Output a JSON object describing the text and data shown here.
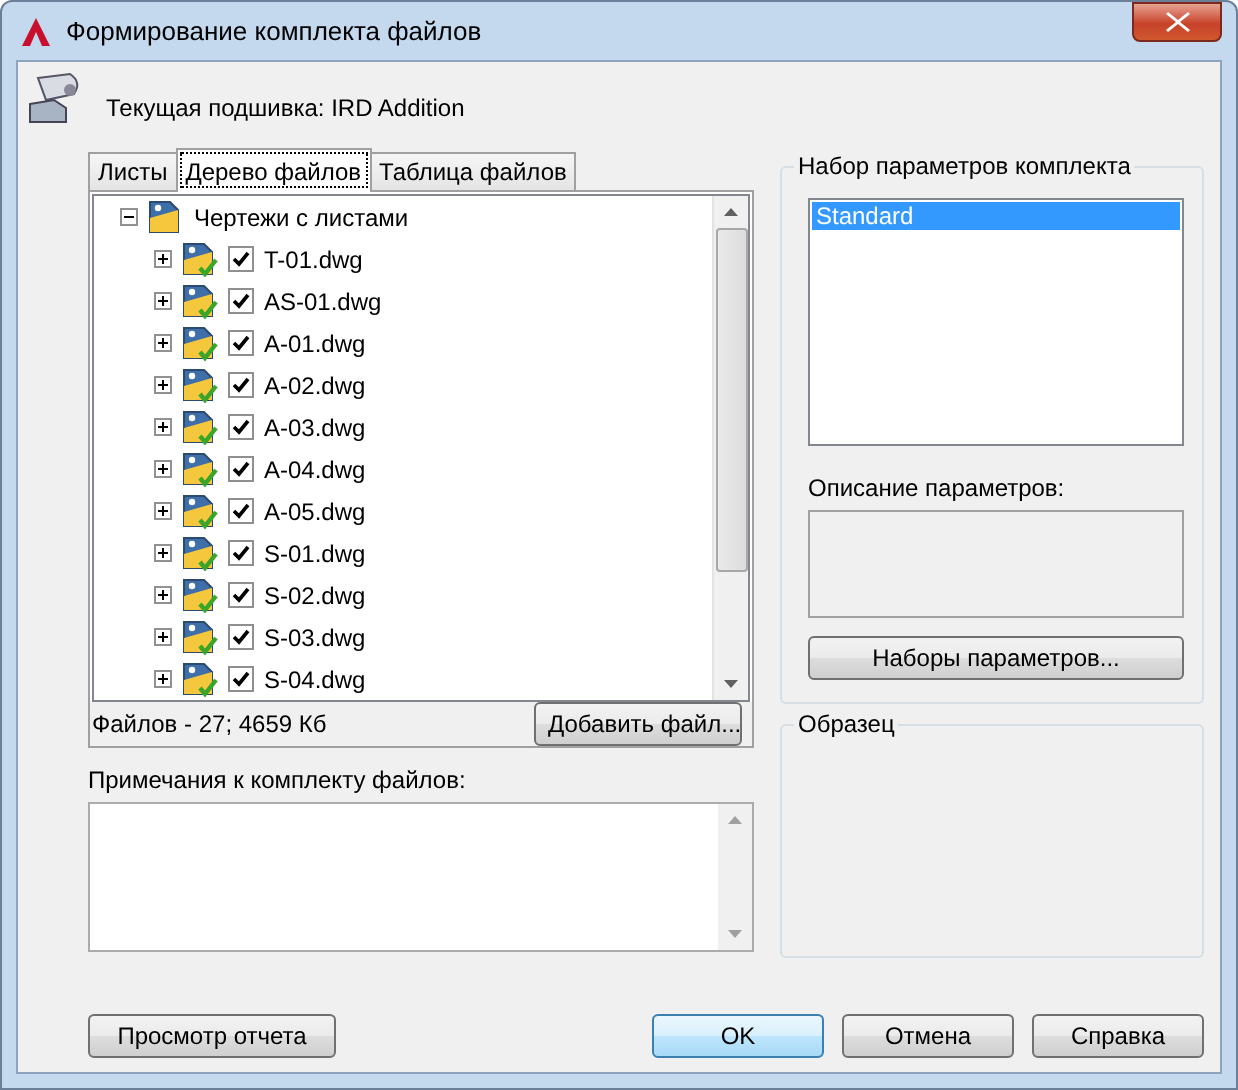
{
  "window": {
    "title": "Формирование комплекта файлов"
  },
  "current_sheet_set": "Текущая подшивка: IRD Addition",
  "tabs": [
    {
      "label": "Листы",
      "selected": false
    },
    {
      "label": "Дерево файлов",
      "selected": true
    },
    {
      "label": "Таблица файлов",
      "selected": false
    }
  ],
  "tree": {
    "label": "Чертежи с листами",
    "expanded": true,
    "children": [
      {
        "label": "T-01.dwg",
        "checked": true,
        "expanded": false
      },
      {
        "label": "AS-01.dwg",
        "checked": true,
        "expanded": false
      },
      {
        "label": "A-01.dwg",
        "checked": true,
        "expanded": false
      },
      {
        "label": "A-02.dwg",
        "checked": true,
        "expanded": false
      },
      {
        "label": "A-03.dwg",
        "checked": true,
        "expanded": false
      },
      {
        "label": "A-04.dwg",
        "checked": true,
        "expanded": false
      },
      {
        "label": "A-05.dwg",
        "checked": true,
        "expanded": false
      },
      {
        "label": "S-01.dwg",
        "checked": true,
        "expanded": false
      },
      {
        "label": "S-02.dwg",
        "checked": true,
        "expanded": false
      },
      {
        "label": "S-03.dwg",
        "checked": true,
        "expanded": false
      },
      {
        "label": "S-04.dwg",
        "checked": true,
        "expanded": false
      }
    ]
  },
  "files_summary": "Файлов - 27; 4659 Кб",
  "add_file_button": "Добавить файл...",
  "notes": {
    "label": "Примечания к комплекту файлов:"
  },
  "parameter_sets": {
    "title": "Набор параметров комплекта",
    "items": [
      {
        "label": "Standard",
        "selected": true
      }
    ],
    "description_label": "Описание параметров:",
    "button": "Наборы параметров..."
  },
  "preview": {
    "title": "Образец"
  },
  "buttons": [
    {
      "label": "Просмотр отчета",
      "default": false
    },
    {
      "label": "OK",
      "default": true
    },
    {
      "label": "Отмена",
      "default": false
    },
    {
      "label": "Справка",
      "default": false
    }
  ]
}
